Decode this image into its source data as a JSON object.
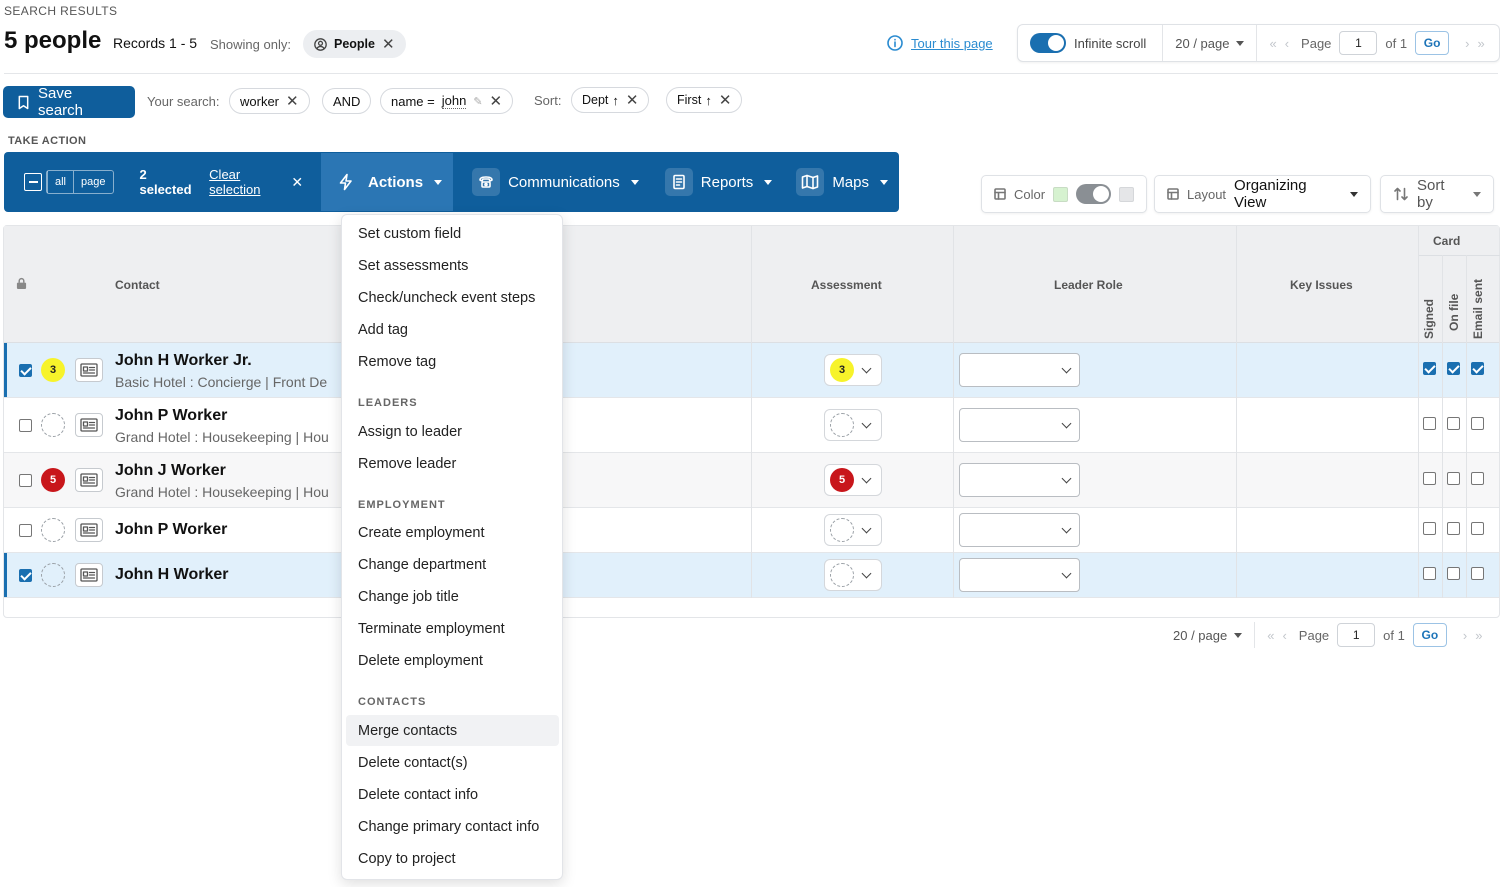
{
  "header": {
    "eyebrow": "SEARCH RESULTS",
    "title": "5 people",
    "records": "Records 1 - 5",
    "showing_label": "Showing only:",
    "showing_chip": "People",
    "tour_link": "Tour this page"
  },
  "pager_top": {
    "infinite_scroll": "Infinite scroll",
    "per_page": "20 / page",
    "page_label": "Page",
    "page_value": "1",
    "of_label": "of 1",
    "go": "Go"
  },
  "search": {
    "save_button": "Save search",
    "your_search_label": "Your search:",
    "term_1": "worker",
    "operator": "AND",
    "term_2_field": "name =",
    "term_2_value": "john",
    "sort_label": "Sort:",
    "sort_1": "Dept",
    "sort_2": "First"
  },
  "take_action": {
    "label": "TAKE ACTION",
    "sel_all": "all",
    "sel_page": "page",
    "selected_count": "2 selected",
    "clear_selection": "Clear selection",
    "actions": "Actions",
    "communications": "Communications",
    "reports": "Reports",
    "maps": "Maps"
  },
  "view_controls": {
    "color_label": "Color",
    "layout_label": "Layout",
    "layout_value": "Organizing View",
    "sort_by": "Sort by",
    "swatch_on": "#d6f2d0",
    "swatch_off": "#e5e6e8"
  },
  "table": {
    "col_contact": "Contact",
    "col_assessment": "Assessment",
    "col_leader_role": "Leader Role",
    "col_key_issues": "Key Issues",
    "col_card": "Card",
    "col_signed": "Signed",
    "col_on_file": "On file",
    "col_email_sent": "Email sent",
    "rows": [
      {
        "name": "John H Worker Jr.",
        "sub": "Basic Hotel : Concierge | Front De",
        "score": "3",
        "selected": true
      },
      {
        "name": "John P Worker",
        "sub": "Grand Hotel : Housekeeping | Hou",
        "score": "",
        "selected": false
      },
      {
        "name": "John J Worker",
        "sub": "Grand Hotel : Housekeeping | Hou",
        "score": "5",
        "selected": false
      },
      {
        "name": "John P Worker",
        "sub": "",
        "score": "",
        "selected": false
      },
      {
        "name": "John H Worker",
        "sub": "",
        "score": "",
        "selected": true
      }
    ]
  },
  "pager_bottom": {
    "per_page": "20 / page",
    "page_label": "Page",
    "page_value": "1",
    "of_label": "of 1",
    "go": "Go"
  },
  "actions_menu": {
    "items_top": [
      "Set custom field",
      "Set assessments",
      "Check/uncheck event steps",
      "Add tag",
      "Remove tag"
    ],
    "leaders_header": "LEADERS",
    "leaders": [
      "Assign to leader",
      "Remove leader"
    ],
    "employment_header": "EMPLOYMENT",
    "employment": [
      "Create employment",
      "Change department",
      "Change job title",
      "Terminate employment",
      "Delete employment"
    ],
    "contacts_header": "CONTACTS",
    "contacts": [
      "Merge contacts",
      "Delete contact(s)",
      "Delete contact info",
      "Change primary contact info",
      "Copy to project"
    ]
  },
  "colors": {
    "brand": "#0f5e9c",
    "accent_link": "#2a8bd0",
    "selected_row": "#e1f0fb",
    "score_yellow": "#f7f32a",
    "score_red": "#c8161b"
  }
}
